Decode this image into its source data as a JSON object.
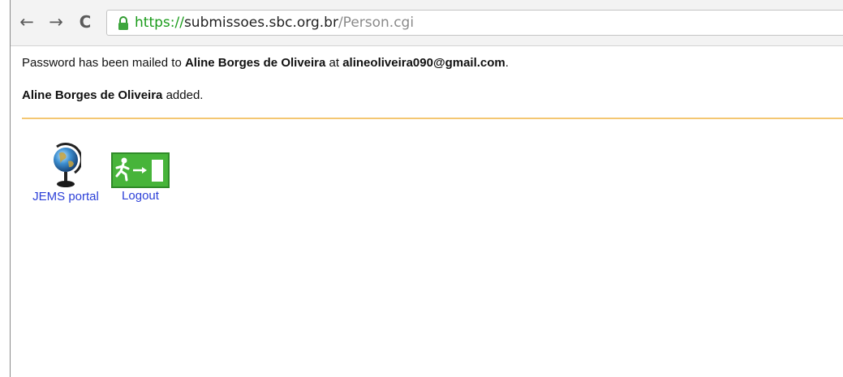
{
  "browser": {
    "back_glyph": "←",
    "forward_glyph": "→",
    "reload_glyph": "C",
    "url": {
      "scheme": "https://",
      "host": "submissoes.sbc.org.br",
      "path": "/Person.cgi"
    }
  },
  "page": {
    "message1": {
      "prefix": "Password has been mailed to ",
      "name": "Aline Borges de Oliveira",
      "middle": " at ",
      "email": "alineoliveira090@gmail.com",
      "suffix": "."
    },
    "message2": {
      "name": "Aline Borges de Oliveira",
      "suffix": " added."
    },
    "links": [
      {
        "label": "JEMS portal",
        "icon": "globe-icon"
      },
      {
        "label": "Logout",
        "icon": "exit-sign-icon"
      }
    ]
  },
  "colors": {
    "link": "#2b3fd8",
    "rule": "#f4c772",
    "secure_scheme": "#1a9b1a",
    "exit_sign_green": "#47b43a"
  }
}
